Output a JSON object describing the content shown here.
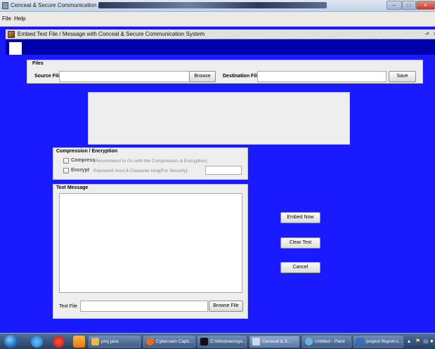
{
  "window": {
    "title": "Cenceal  &  Secure  Communication  System",
    "min_glyph": "–",
    "max_glyph": "□",
    "close_glyph": "×"
  },
  "menu": {
    "items": [
      "File",
      "Help"
    ]
  },
  "internal_frame": {
    "title": "Embed Text File / Message  with  Conceal & Secure Communication System",
    "restore_glyph": "▫ˣ",
    "close_glyph": "×"
  },
  "files": {
    "legend": "Files",
    "source_label": "Source File",
    "source_value": "",
    "browse_label": "Browse",
    "destination_label": "Destination File",
    "destination_value": "",
    "save_label": "Save"
  },
  "compression": {
    "legend": "Compression  /  Encryption",
    "compress_label": "Compress",
    "compress_hint": "(Recommend to Go with the Compression  &  Encryption)",
    "encrypt_label": "Encrypt",
    "encrypt_hint": "Password must 8 Character long(For Security)",
    "password_value": ""
  },
  "text_message": {
    "legend": "Text Message",
    "message_value": "",
    "text_file_label": "Text  File",
    "text_file_value": "",
    "browse_file_label": "Browse File"
  },
  "actions": {
    "embed_label": "Embed Now",
    "clear_label": "Clear Text",
    "cancel_label": "Cancel"
  },
  "taskbar": {
    "items": [
      {
        "label": "proj java",
        "icon": "folder-icon",
        "color": "#e8b84a"
      },
      {
        "label": "Cyberoam Capti...",
        "icon": "firefox-icon",
        "color": "#e07020"
      },
      {
        "label": "C:\\Windows\\sys...",
        "icon": "cmd-icon",
        "color": "#111111"
      },
      {
        "label": "Cenceal  &  S...",
        "icon": "java-icon",
        "color": "#d0d8e8"
      },
      {
        "label": "Untitled - Paint",
        "icon": "paint-icon",
        "color": "#6ab0e0"
      },
      {
        "label": "project Report-c...",
        "icon": "word-icon",
        "color": "#3a6ec0"
      }
    ]
  },
  "colors": {
    "background_blue": "#1a1aff",
    "strip_blue": "#0000aa",
    "panel_gray": "#eeeeee"
  }
}
